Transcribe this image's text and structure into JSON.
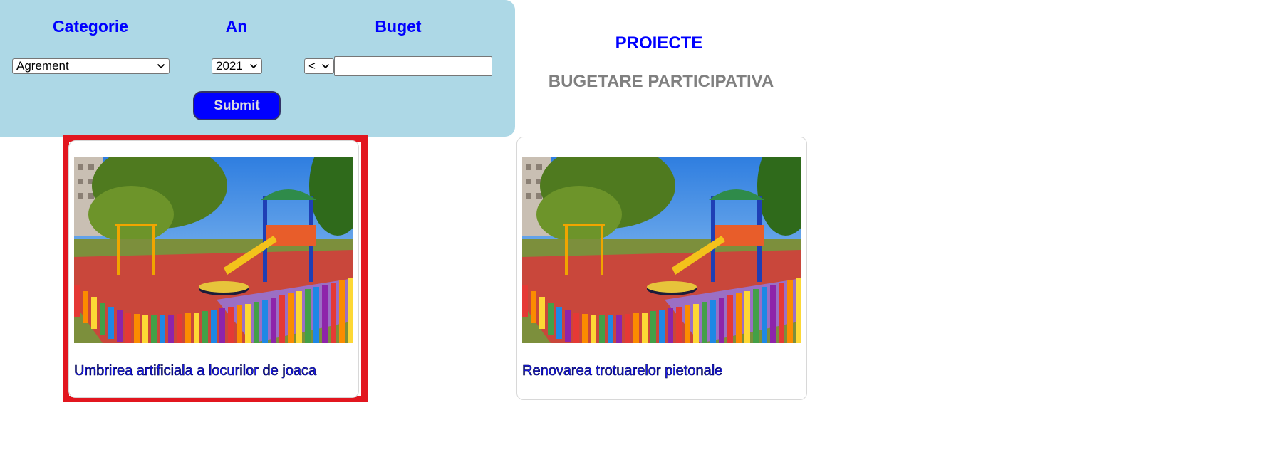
{
  "filters": {
    "category_label": "Categorie",
    "year_label": "An",
    "budget_label": "Buget",
    "category_value": "Agrement",
    "year_value": "2021",
    "operator_value": "<",
    "budget_value": "",
    "submit_label": "Submit"
  },
  "header": {
    "title": "PROIECTE",
    "subtitle": "BUGETARE PARTICIPATIVA"
  },
  "projects": [
    {
      "title": "Umbrirea artificiala a locurilor de joaca",
      "image": "playground-photo",
      "selected": true
    },
    {
      "title": "Renovarea trotuarelor pietonale",
      "image": "playground-photo",
      "selected": false
    }
  ],
  "colors": {
    "panel_bg": "#add8e6",
    "accent": "#0000ff",
    "subtitle": "#808080",
    "highlight": "#e2161f"
  }
}
